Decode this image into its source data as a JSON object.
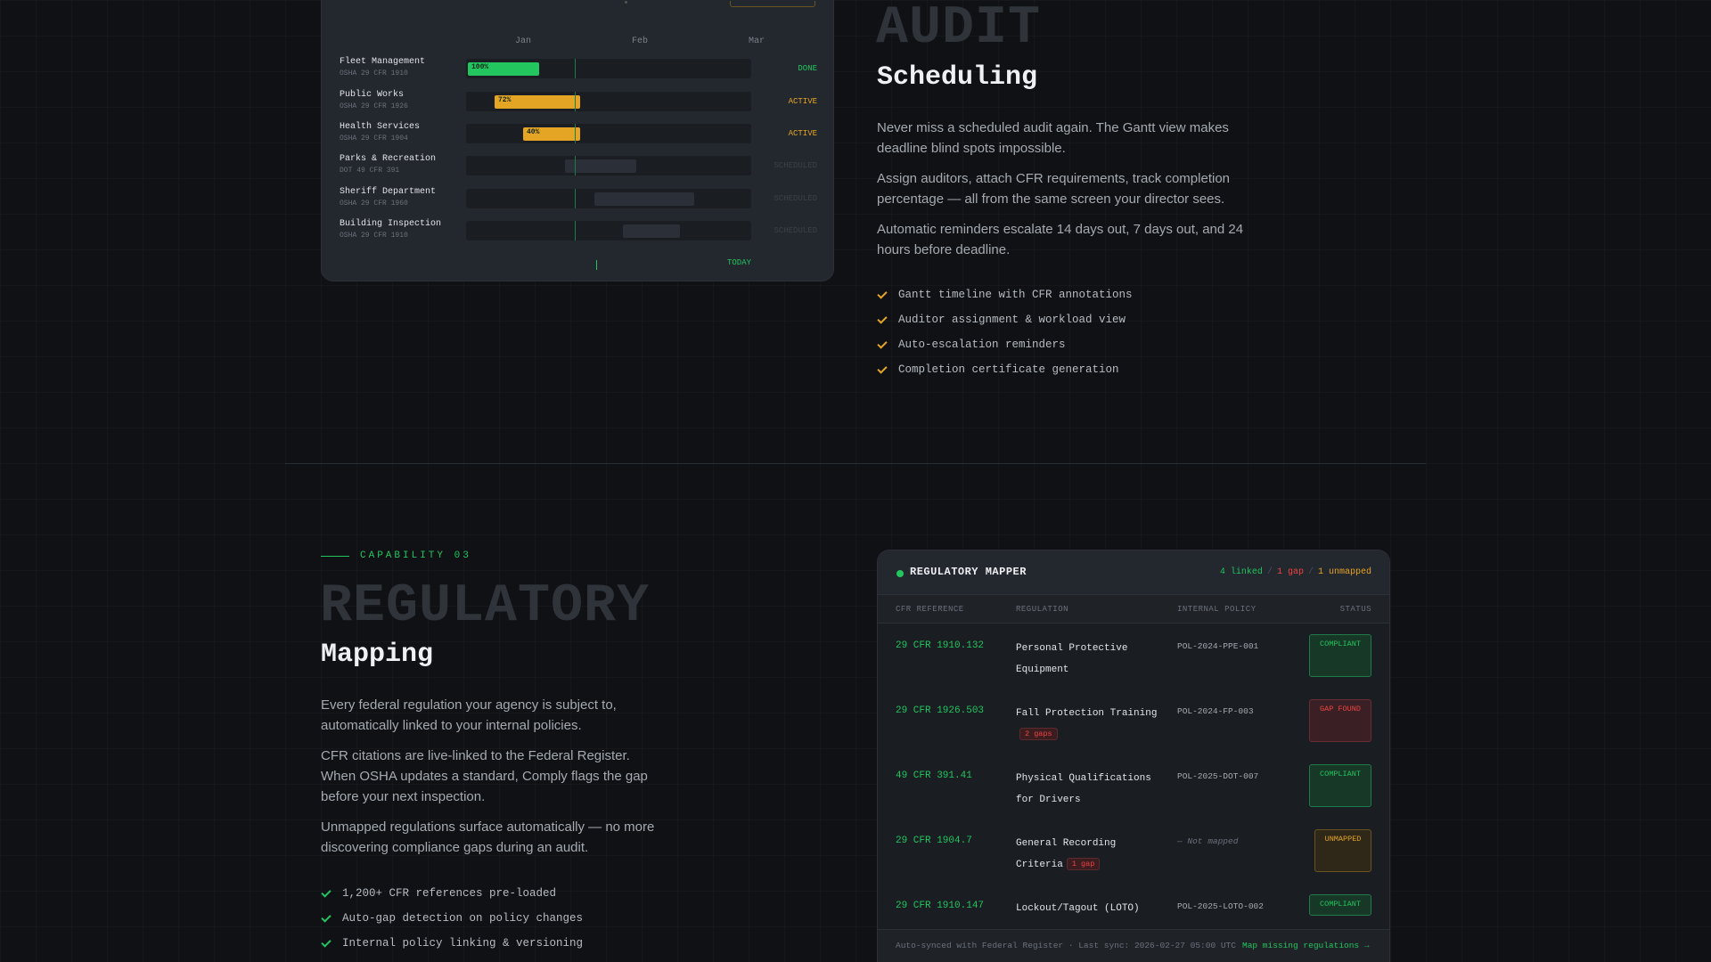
{
  "gantt": {
    "months": [
      "Jan",
      "Feb",
      "Mar"
    ],
    "rows": [
      {
        "name": "Fleet Management",
        "ref": "OSHA 29 CFR 1910",
        "status": "DONE",
        "pct_label": "100%",
        "progress": 100
      },
      {
        "name": "Public Works",
        "ref": "OSHA 29 CFR 1926",
        "status": "ACTIVE",
        "pct_label": "72%",
        "progress": 72
      },
      {
        "name": "Health Services",
        "ref": "OSHA 29 CFR 1904",
        "status": "ACTIVE",
        "pct_label": "40%",
        "progress": 40
      },
      {
        "name": "Parks & Recreation",
        "ref": "DOT 49 CFR 391",
        "status": "SCHEDULED",
        "pct_label": "",
        "progress": 0
      },
      {
        "name": "Sheriff Department",
        "ref": "OSHA 29 CFR 1960",
        "status": "SCHEDULED",
        "pct_label": "",
        "progress": 0
      },
      {
        "name": "Building Inspection",
        "ref": "OSHA 29 CFR 1910",
        "status": "SCHEDULED",
        "pct_label": "",
        "progress": 0
      }
    ],
    "today_label": "TODAY"
  },
  "audit": {
    "ghost_title": "AUDIT",
    "title": "Scheduling",
    "paragraphs": [
      "Never miss a scheduled audit again. The Gantt view makes deadline blind spots impossible.",
      "Assign auditors, attach CFR requirements, track completion percentage — all from the same screen your director sees.",
      "Automatic reminders escalate 14 days out, 7 days out, and 24 hours before deadline."
    ],
    "features": [
      "Gantt timeline with CFR annotations",
      "Auditor assignment & workload view",
      "Auto-escalation reminders",
      "Completion certificate generation"
    ]
  },
  "capability": {
    "label": "CAPABILITY 03",
    "ghost_title": "REGULATORY",
    "title": "Mapping",
    "paragraphs": [
      "Every federal regulation your agency is subject to, automatically linked to your internal policies.",
      "CFR citations are live-linked to the Federal Register. When OSHA updates a standard, Comply flags the gap before your next inspection.",
      "Unmapped regulations surface automatically — no more discovering compliance gaps during an audit."
    ],
    "features": [
      "1,200+ CFR references pre-loaded",
      "Auto-gap detection on policy changes",
      "Internal policy linking & versioning"
    ]
  },
  "mapper": {
    "title": "REGULATORY MAPPER",
    "stats": {
      "linked": "4 linked",
      "gap": "1 gap",
      "unmapped": "1 unmapped",
      "sep": "/"
    },
    "columns": [
      "CFR REFERENCE",
      "REGULATION",
      "INTERNAL POLICY",
      "STATUS"
    ],
    "rows": [
      {
        "ref": "29 CFR 1910.132",
        "regulation": "Personal Protective Equipment",
        "gaps": "",
        "policy": "POL-2024-PPE-001",
        "status": "COMPLIANT"
      },
      {
        "ref": "29 CFR 1926.503",
        "regulation": "Fall Protection Training",
        "gaps": "2 gaps",
        "policy": "POL-2024-FP-003",
        "status": "GAP FOUND"
      },
      {
        "ref": "49 CFR 391.41",
        "regulation": "Physical Qualifications for Drivers",
        "gaps": "",
        "policy": "POL-2025-DOT-007",
        "status": "COMPLIANT"
      },
      {
        "ref": "29 CFR 1904.7",
        "regulation": "General Recording Criteria",
        "gaps": "1 gap",
        "policy": "— Not mapped",
        "status": "UNMAPPED"
      },
      {
        "ref": "29 CFR 1910.147",
        "regulation": "Lockout/Tagout (LOTO)",
        "gaps": "",
        "policy": "POL-2025-LOTO-002",
        "status": "COMPLIANT"
      }
    ],
    "footer_text": "Auto-synced with Federal Register · Last sync: 2026-02-27 05:00 UTC",
    "footer_link": "Map missing regulations →"
  },
  "colors": {
    "accent_green": "#22c55e",
    "accent_amber": "#e5a524",
    "accent_red": "#ef4444",
    "background": "#0f1114"
  }
}
